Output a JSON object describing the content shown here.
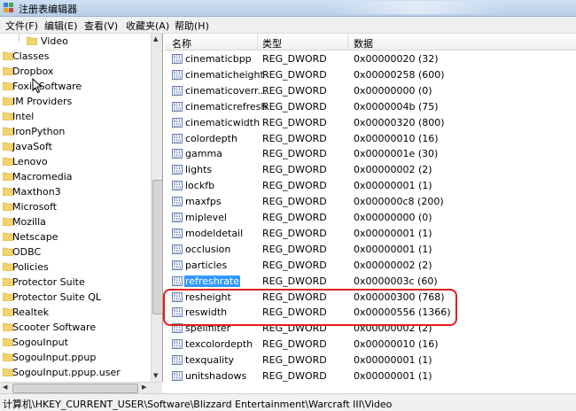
{
  "window": {
    "title": "注册表编辑器"
  },
  "menu": [
    "文件(F)",
    "编辑(E)",
    "查看(V)",
    "收藏夹(A)",
    "帮助(H)"
  ],
  "tree": {
    "selected": "Video",
    "items": [
      "Classes",
      "Dropbox",
      "Foxit Software",
      "IM Providers",
      "Intel",
      "IronPython",
      "JavaSoft",
      "Lenovo",
      "Macromedia",
      "Maxthon3",
      "Microsoft",
      "Mozilla",
      "Netscape",
      "ODBC",
      "Policies",
      "Protector Suite",
      "Protector Suite QL",
      "Realtek",
      "Scooter Software",
      "SogouInput",
      "SogouInput.ppup",
      "SogouInput.ppup.user"
    ]
  },
  "list": {
    "headers": {
      "name": "名称",
      "type": "类型",
      "data": "数据"
    },
    "rows": [
      {
        "name": "cinematicbpp",
        "type": "REG_DWORD",
        "data": "0x00000020 (32)"
      },
      {
        "name": "cinematicheight",
        "type": "REG_DWORD",
        "data": "0x00000258 (600)"
      },
      {
        "name": "cinematicoverr...",
        "type": "REG_DWORD",
        "data": "0x00000000 (0)"
      },
      {
        "name": "cinematicrefresh",
        "type": "REG_DWORD",
        "data": "0x0000004b (75)"
      },
      {
        "name": "cinematicwidth",
        "type": "REG_DWORD",
        "data": "0x00000320 (800)"
      },
      {
        "name": "colordepth",
        "type": "REG_DWORD",
        "data": "0x00000010 (16)"
      },
      {
        "name": "gamma",
        "type": "REG_DWORD",
        "data": "0x0000001e (30)"
      },
      {
        "name": "lights",
        "type": "REG_DWORD",
        "data": "0x00000002 (2)"
      },
      {
        "name": "lockfb",
        "type": "REG_DWORD",
        "data": "0x00000001 (1)"
      },
      {
        "name": "maxfps",
        "type": "REG_DWORD",
        "data": "0x000000c8 (200)"
      },
      {
        "name": "miplevel",
        "type": "REG_DWORD",
        "data": "0x00000000 (0)"
      },
      {
        "name": "modeldetail",
        "type": "REG_DWORD",
        "data": "0x00000001 (1)"
      },
      {
        "name": "occlusion",
        "type": "REG_DWORD",
        "data": "0x00000001 (1)"
      },
      {
        "name": "particles",
        "type": "REG_DWORD",
        "data": "0x00000002 (2)"
      },
      {
        "name": "refreshrate",
        "type": "REG_DWORD",
        "data": "0x0000003c (60)",
        "selected": true
      },
      {
        "name": "resheight",
        "type": "REG_DWORD",
        "data": "0x00000300 (768)"
      },
      {
        "name": "reswidth",
        "type": "REG_DWORD",
        "data": "0x00000556 (1366)"
      },
      {
        "name": "spellfilter",
        "type": "REG_DWORD",
        "data": "0x00000002 (2)"
      },
      {
        "name": "texcolordepth",
        "type": "REG_DWORD",
        "data": "0x00000010 (16)"
      },
      {
        "name": "texquality",
        "type": "REG_DWORD",
        "data": "0x00000001 (1)"
      },
      {
        "name": "unitshadows",
        "type": "REG_DWORD",
        "data": "0x00000001 (1)"
      }
    ]
  },
  "status": {
    "path": "计算机\\HKEY_CURRENT_USER\\Software\\Blizzard Entertainment\\Warcraft III\\Video"
  },
  "colors": {
    "selection": "#3399ff",
    "highlight_box": "#e21b1b",
    "folder": "#f3d36b"
  }
}
